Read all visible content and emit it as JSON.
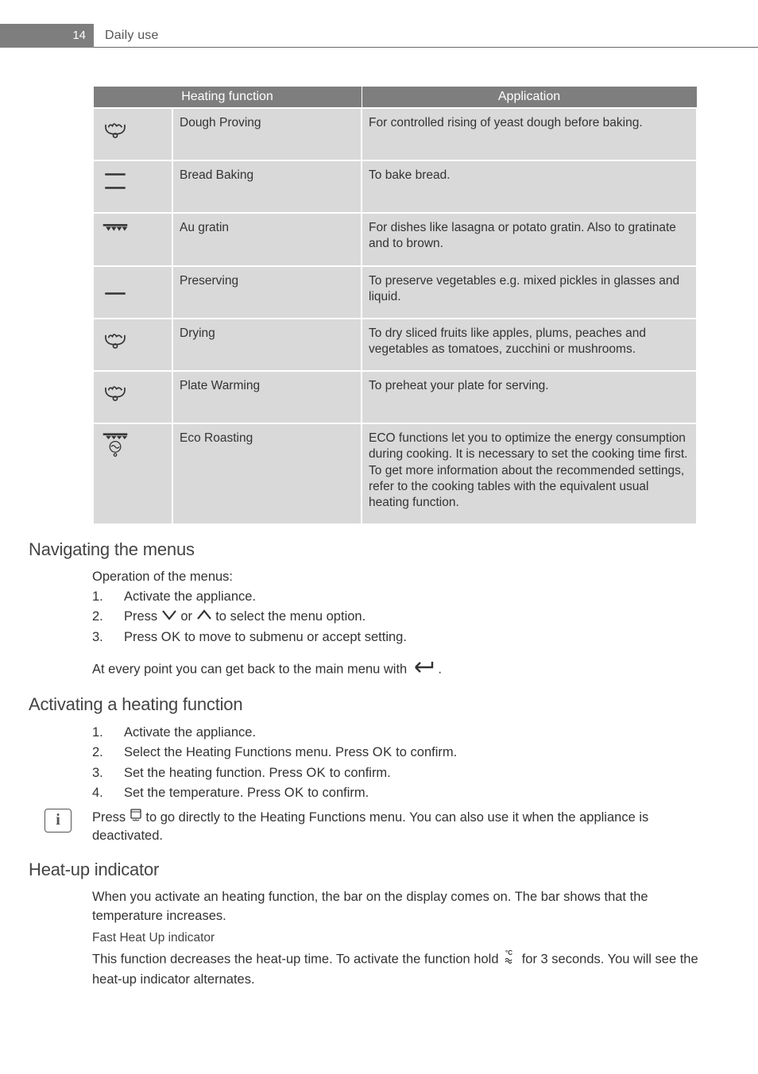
{
  "header": {
    "page_number": "14",
    "section_title": "Daily use"
  },
  "table": {
    "headers": {
      "func": "Heating function",
      "app": "Application"
    },
    "rows": [
      {
        "name": "Dough Proving",
        "app": "For controlled rising of yeast dough before baking."
      },
      {
        "name": "Bread Baking",
        "app": "To bake bread."
      },
      {
        "name": "Au gratin",
        "app": "For dishes like lasagna or potato gratin. Also to gratinate and to brown."
      },
      {
        "name": "Preserving",
        "app": "To preserve vegetables e.g. mixed pickles in glasses and liquid."
      },
      {
        "name": "Drying",
        "app": "To dry sliced fruits like apples, plums, peaches and vegetables as tomatoes, zucchini or mushrooms."
      },
      {
        "name": "Plate Warming",
        "app": "To preheat your plate for serving."
      },
      {
        "name": "Eco Roasting",
        "app": "ECO functions let you to optimize the energy consumption during cooking. It is necessary to set the cooking time first. To get more information about the recommended settings, refer to the cooking tables with the equivalent usual heating function."
      }
    ]
  },
  "nav": {
    "heading": "Navigating the menus",
    "intro": "Operation of the menus:",
    "steps": {
      "s1": "Activate the appliance.",
      "s2a": "Press ",
      "s2b": " or ",
      "s2c": " to select the menu option.",
      "s3a": "Press ",
      "s3ok": "OK",
      "s3b": " to move to submenu or accept setting."
    },
    "note_a": "At every point you can get back to the main menu with ",
    "note_b": " ."
  },
  "activate": {
    "heading": "Activating a heating function",
    "steps": {
      "s1": "Activate the appliance.",
      "s2a": "Select the Heating Functions menu. Press ",
      "s2ok": "OK",
      "s2b": " to confirm.",
      "s3a": "Set the heating function. Press ",
      "s3ok": "OK",
      "s3b": " to confirm.",
      "s4a": "Set the temperature. Press ",
      "s4ok": "OK",
      "s4b": " to confirm."
    },
    "info_a": "Press ",
    "info_b": " to go directly to the Heating Functions menu. You can also use it when the appliance is deactivated."
  },
  "heatup": {
    "heading": "Heat-up indicator",
    "p1": "When you activate an heating function, the bar on the display comes on. The bar shows that the temperature increases.",
    "sub": "Fast Heat Up indicator",
    "p2a": "This function decreases the heat-up time. To activate the function hold ",
    "p2b": " for 3 seconds. You will see the heat-up indicator alternates."
  }
}
